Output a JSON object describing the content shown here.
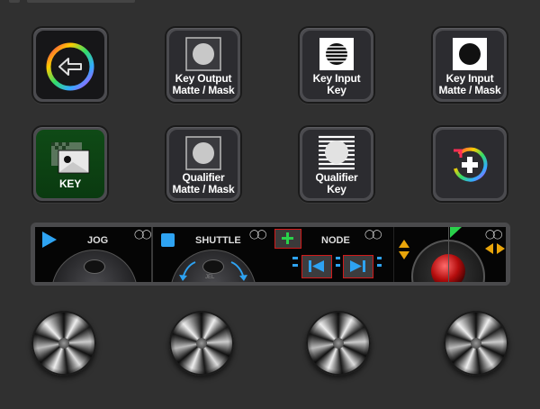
{
  "softkeys": {
    "back": {
      "label": ""
    },
    "key_output_matte": {
      "label_line1": "Key Output",
      "label_line2": "Matte / Mask"
    },
    "key_input_key": {
      "label_line1": "Key Input",
      "label_line2": "Key"
    },
    "key_input_matte": {
      "label_line1": "Key Input",
      "label_line2": "Matte / Mask"
    },
    "key": {
      "label_line1": "KEY"
    },
    "qualifier_matte": {
      "label_line1": "Qualifier",
      "label_line2": "Matte / Mask"
    },
    "qualifier_key": {
      "label_line1": "Qualifier",
      "label_line2": "Key"
    },
    "add_node": {
      "label": ""
    }
  },
  "strip": {
    "jog_label": "JOG",
    "shuttle_label": "SHUTTLE",
    "node_label": "NODE",
    "shuttle_sub": "JEL",
    "colors": {
      "accent": "#2ea3f2",
      "node_green": "#29d14a",
      "node_border": "#d21b1b",
      "arrow_gold": "#e9a50a"
    }
  },
  "knobs": [
    "knob-1",
    "knob-2",
    "knob-3",
    "knob-4"
  ]
}
